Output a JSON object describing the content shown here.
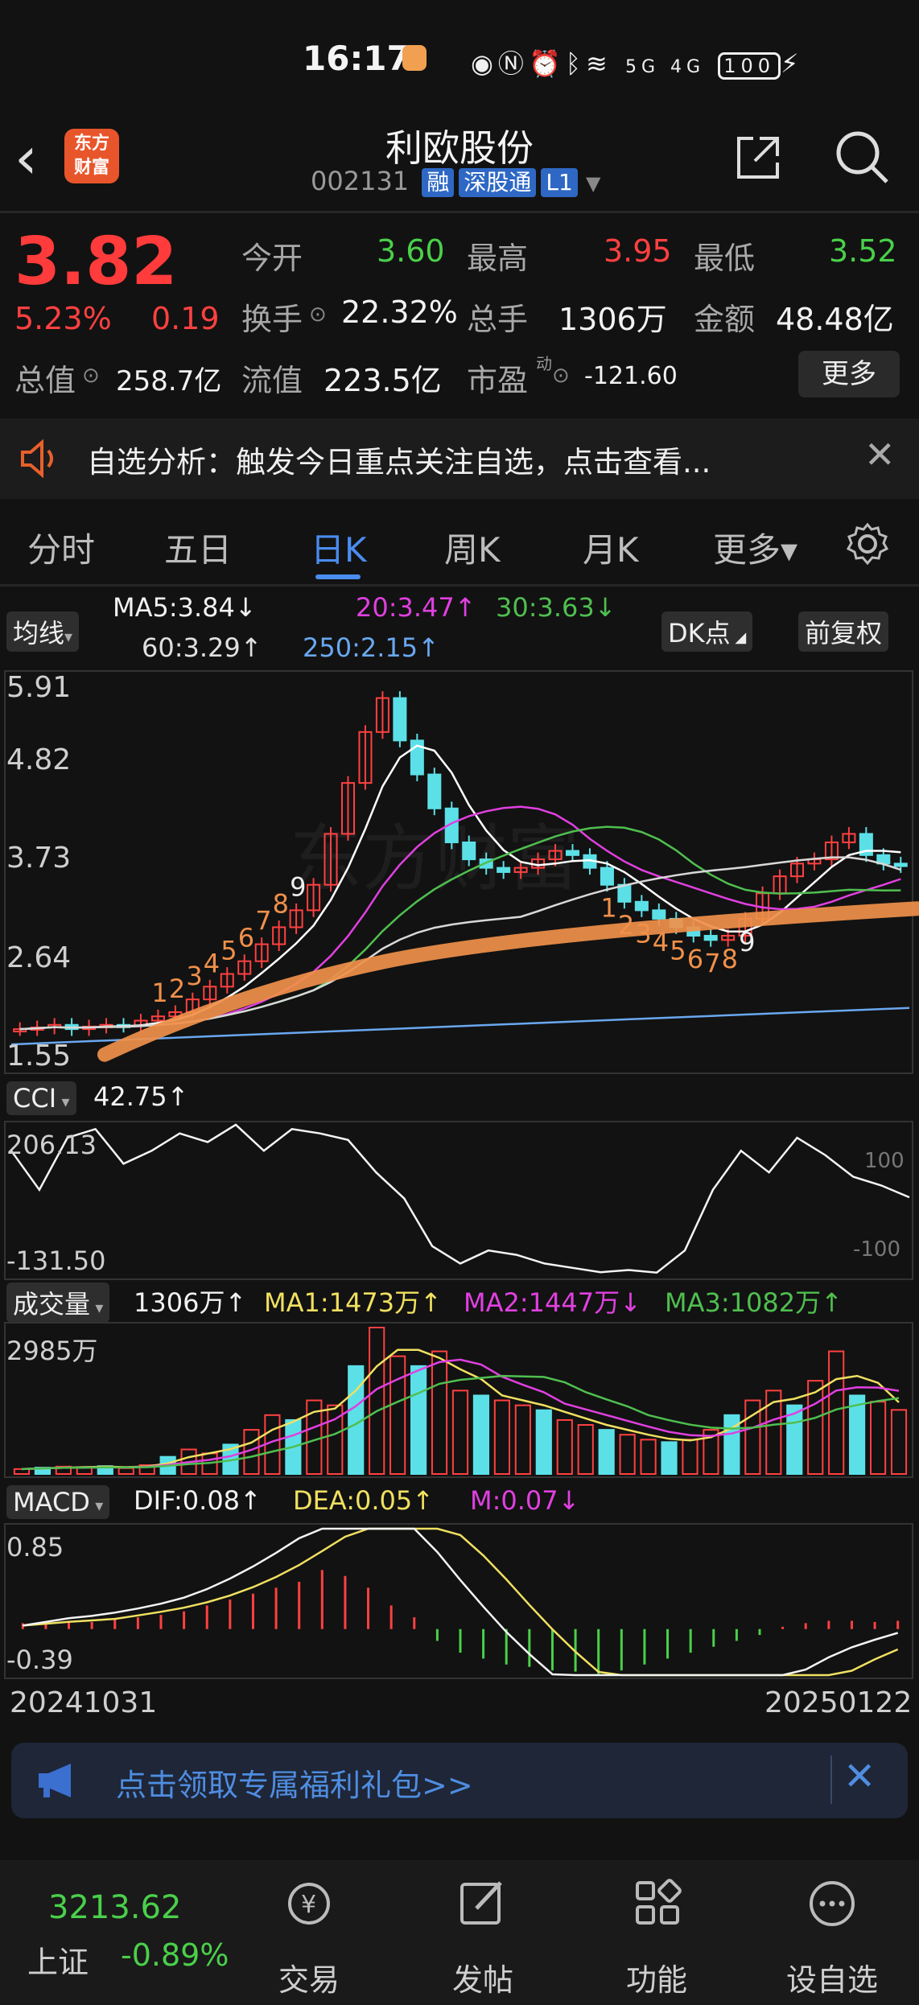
{
  "status_bar": {
    "time": "16:17",
    "network": "5G 4G",
    "battery": "100"
  },
  "header": {
    "logo": "东方财富",
    "stock_name": "利欧股份",
    "stock_code": "002131",
    "tags": [
      "融",
      "深股通",
      "L1"
    ]
  },
  "quote": {
    "price": "3.82",
    "change_pct": "5.23%",
    "change": "0.19",
    "open_label": "今开",
    "open": "3.60",
    "high_label": "最高",
    "high": "3.95",
    "low_label": "最低",
    "low": "3.52",
    "turnover_label": "换手",
    "turnover": "22.32%",
    "volume_label": "总手",
    "volume": "1306万",
    "amount_label": "金额",
    "amount": "48.48亿",
    "mktcap_label": "总值",
    "mktcap": "258.7亿",
    "float_label": "流值",
    "float": "223.5亿",
    "pe_label": "市盈",
    "pe_sup": "动",
    "pe": "-121.60",
    "more": "更多"
  },
  "notice": {
    "text": "自选分析：触发今日重点关注自选，点击查看..."
  },
  "tabs": [
    "分时",
    "五日",
    "日K",
    "周K",
    "月K",
    "更多▾"
  ],
  "active_tab": "日K",
  "kline": {
    "selector": "均线",
    "ma5": "MA5:3.84↓",
    "ma20": "20:3.47↑",
    "ma30": "30:3.63↓",
    "ma60": "60:3.29↑",
    "ma250": "250:2.15↑",
    "dk_button": "DK点",
    "adjust_button": "前复权",
    "y_ticks": [
      "5.91",
      "4.82",
      "3.73",
      "2.64",
      "1.55"
    ],
    "td_up": [
      "1",
      "2",
      "3",
      "4",
      "5",
      "6",
      "7",
      "8",
      "9"
    ],
    "td_down": [
      "1",
      "2",
      "3",
      "4",
      "5",
      "6",
      "7",
      "8",
      "9"
    ],
    "watermark": "东方财富"
  },
  "cci": {
    "selector": "CCI",
    "value": "42.75↑",
    "max": "206.13",
    "min": "-131.50",
    "ref_hi": "100",
    "ref_lo": "-100"
  },
  "volume": {
    "selector": "成交量",
    "value": "1306万↑",
    "ma1": "MA1:1473万↑",
    "ma2": "MA2:1447万↓",
    "ma3": "MA3:1082万↑",
    "max": "2985万"
  },
  "macd": {
    "selector": "MACD",
    "dif": "DIF:0.08↑",
    "dea": "DEA:0.05↑",
    "m": "M:0.07↓",
    "max": "0.85",
    "min": "-0.39"
  },
  "dates": {
    "start": "20241031",
    "end": "20250122"
  },
  "banner": {
    "text": "点击领取专属福利礼包>>"
  },
  "nav": {
    "index_value": "3213.62",
    "index_name": "上证",
    "index_change": "-0.89%",
    "items": [
      "交易",
      "发帖",
      "功能",
      "设自选"
    ]
  },
  "colors": {
    "up": "#ff4040",
    "down": "#4ad04a",
    "accent": "#4a8cf0",
    "candle_down": "#5ce0e8",
    "ma5": "#ffffff",
    "ma20": "#e040e0",
    "ma30": "#4fbf4f",
    "ma60": "#d8d8d8",
    "ma250": "#6aa8f0",
    "dea": "#f0e060",
    "trend": "#f0904a"
  },
  "chart_data": [
    {
      "type": "candlestick",
      "title": "",
      "x": [
        "20241031",
        "20250122"
      ],
      "ylim": [
        1.55,
        5.91
      ],
      "y_ticks": [
        5.91,
        4.82,
        3.73,
        2.64,
        1.55
      ],
      "close_path": [
        1.9,
        1.92,
        1.95,
        1.9,
        1.93,
        1.95,
        1.94,
        2.0,
        2.05,
        2.1,
        2.25,
        2.4,
        2.55,
        2.7,
        2.9,
        3.1,
        3.3,
        3.6,
        4.2,
        4.8,
        5.4,
        5.8,
        5.3,
        4.9,
        4.5,
        4.1,
        3.9,
        3.8,
        3.75,
        3.8,
        3.9,
        4.0,
        3.95,
        3.8,
        3.6,
        3.4,
        3.3,
        3.2,
        3.1,
        3.0,
        2.95,
        3.0,
        3.2,
        3.5,
        3.7,
        3.85,
        3.9,
        4.1,
        4.2,
        3.95,
        3.85,
        3.82
      ]
    },
    {
      "type": "line",
      "title": "CCI",
      "ylim": [
        -131.5,
        206.13
      ],
      "values": [
        150,
        60,
        180,
        200,
        120,
        150,
        190,
        170,
        210,
        150,
        200,
        190,
        175,
        100,
        40,
        -70,
        -110,
        -80,
        -90,
        -110,
        -120,
        -130,
        -125,
        -131,
        -80,
        60,
        150,
        100,
        180,
        140,
        90,
        70,
        42.75
      ]
    },
    {
      "type": "bar",
      "title": "成交量",
      "ylim": [
        0,
        2985
      ],
      "values": [
        100,
        130,
        150,
        140,
        160,
        120,
        180,
        350,
        500,
        420,
        600,
        900,
        1200,
        1100,
        1500,
        1400,
        2200,
        2985,
        2400,
        2200,
        2500,
        1700,
        1600,
        1500,
        1400,
        1300,
        1100,
        1000,
        900,
        800,
        700,
        650,
        700,
        900,
        1200,
        1500,
        1700,
        1400,
        1900,
        2500,
        1600,
        1473,
        1306
      ]
    },
    {
      "type": "bar",
      "title": "MACD",
      "ylim": [
        -0.39,
        0.85
      ],
      "values": [
        0.05,
        0.06,
        0.07,
        0.06,
        0.08,
        0.1,
        0.12,
        0.15,
        0.2,
        0.25,
        0.3,
        0.35,
        0.4,
        0.5,
        0.45,
        0.35,
        0.2,
        0.1,
        -0.1,
        -0.2,
        -0.25,
        -0.3,
        -0.32,
        -0.35,
        -0.36,
        -0.38,
        -0.35,
        -0.3,
        -0.25,
        -0.2,
        -0.15,
        -0.1,
        -0.05,
        0.02,
        0.05,
        0.07,
        0.07,
        0.06,
        0.07
      ]
    }
  ]
}
